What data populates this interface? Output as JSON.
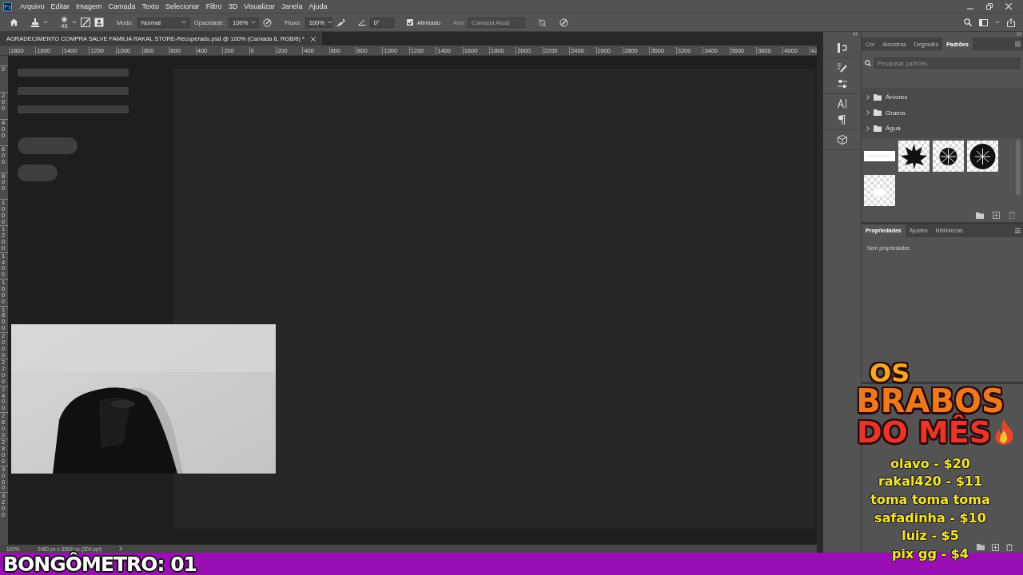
{
  "app_logo": "Ps",
  "menu": [
    "Arquivo",
    "Editar",
    "Imagem",
    "Camada",
    "Texto",
    "Selecionar",
    "Filtro",
    "3D",
    "Visualizar",
    "Janela",
    "Ajuda"
  ],
  "options_bar": {
    "brush_size": "46",
    "mode_label": "Modo:",
    "mode": "Normal",
    "opacity_label": "Opacidade:",
    "opacity": "100%",
    "flow_label": "Fluxo:",
    "flow": "100%",
    "angle": "0°",
    "aligned": {
      "label": "Alinhado",
      "checked": true
    },
    "sample_label": {
      "text": "Amt",
      "disabled": true
    },
    "sample": {
      "value": "Camada Atual",
      "disabled": true
    }
  },
  "document_tab": {
    "title": "AGRADECIMENTO COMPRA SALVE FAMILIA RAKAL STORE-Recuperado.psd @ 100% (Camada 6, RGB/8) *"
  },
  "rulers": {
    "horizontal": [
      "1800",
      "1600",
      "1400",
      "1200",
      "1000",
      "800",
      "600",
      "400",
      "200",
      "0",
      "200",
      "400",
      "600",
      "800",
      "1000",
      "1200",
      "1400",
      "1600",
      "1800",
      "2000",
      "2200",
      "2400",
      "2600",
      "2800",
      "3000",
      "3200",
      "3400",
      "3600",
      "3800",
      "4000",
      "42"
    ],
    "vertical": [
      "0",
      "200",
      "400",
      "600",
      "800",
      "1000",
      "1200",
      "1400",
      "1600",
      "1800",
      "2000",
      "2200",
      "2400",
      "2600",
      "2800",
      "3000",
      "3200"
    ]
  },
  "status_bar": {
    "zoom": "100%",
    "info": "2480 px x 3508 px (300 ppi)"
  },
  "patterns_panel": {
    "tabs": [
      {
        "label": "Cor",
        "selected": false
      },
      {
        "label": "Amostras",
        "selected": false
      },
      {
        "label": "Degradês",
        "selected": false
      },
      {
        "label": "Padrões",
        "selected": true
      }
    ],
    "search": {
      "placeholder": "Pesquisar padrões"
    },
    "groups": [
      {
        "label": "Árvores",
        "expanded": false
      },
      {
        "label": "Grama",
        "expanded": false
      },
      {
        "label": "Água",
        "expanded": false
      }
    ]
  },
  "properties_panel": {
    "tabs": [
      {
        "label": "Propriedades",
        "selected": true
      },
      {
        "label": "Ajustes",
        "selected": false
      },
      {
        "label": "Bibliotecas",
        "selected": false
      }
    ],
    "message": "Sem propriedades"
  },
  "overlay": {
    "title_lines": [
      "OS",
      "BRABOS",
      "DO MÊS"
    ],
    "donations": [
      "olavo - $20",
      "rakal420 - $11",
      "toma toma toma",
      "safadinha - $10",
      "luiz - $5",
      "pix gg - $4"
    ]
  },
  "counter": "BONGÔMETRO: 01"
}
